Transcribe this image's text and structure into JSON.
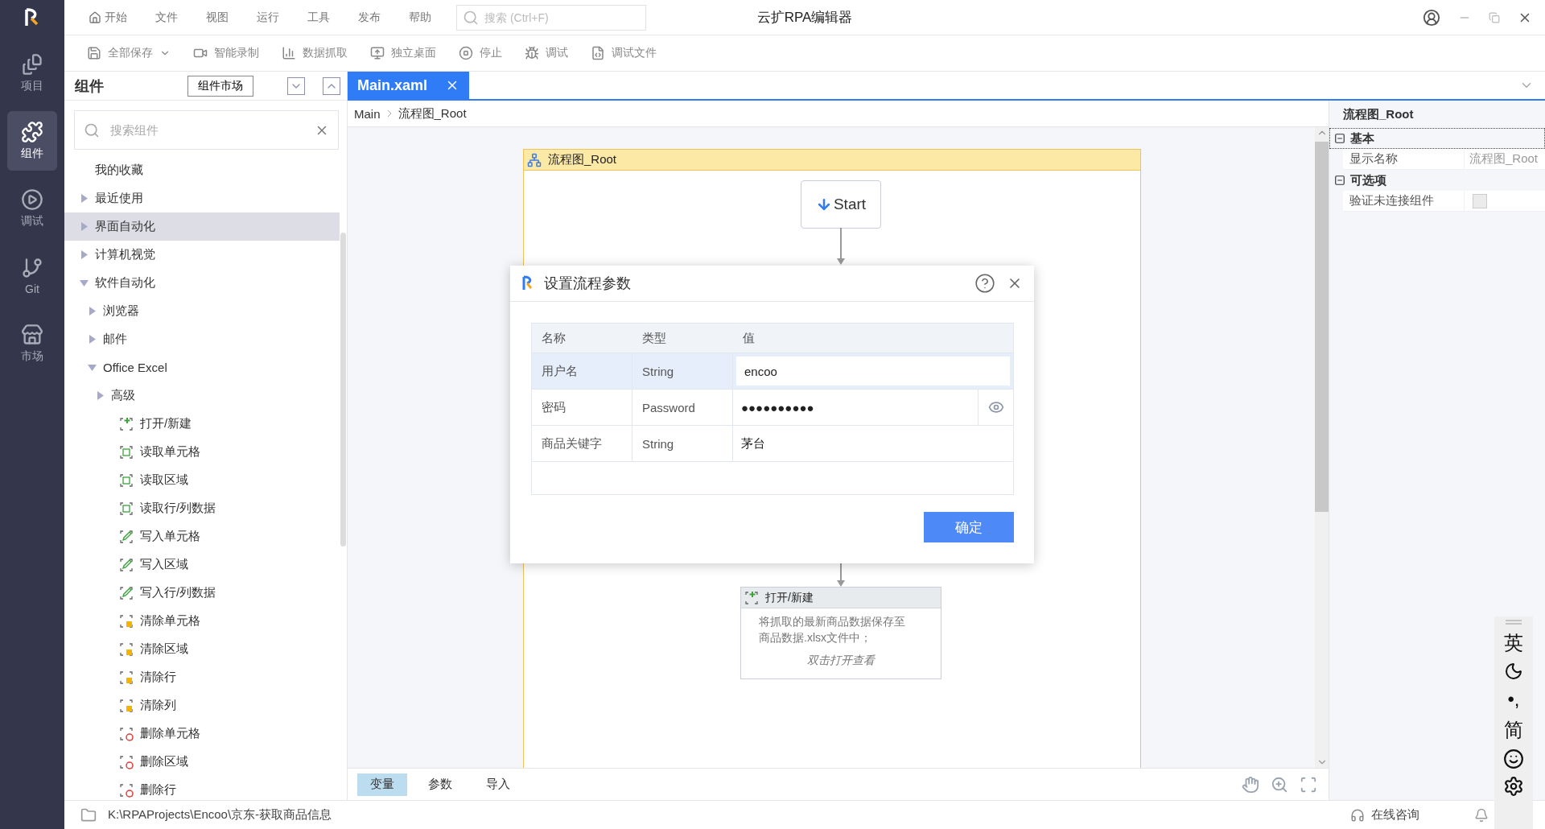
{
  "window": {
    "title": "云扩RPA编辑器"
  },
  "menu": [
    {
      "label": "开始",
      "kind": "home"
    },
    {
      "label": "文件",
      "kind": "text"
    },
    {
      "label": "视图",
      "kind": "text"
    },
    {
      "label": "运行",
      "kind": "text"
    },
    {
      "label": "工具",
      "kind": "text"
    },
    {
      "label": "发布",
      "kind": "text"
    },
    {
      "label": "帮助",
      "kind": "text"
    }
  ],
  "search": {
    "placeholder": "搜索 (Ctrl+F)"
  },
  "toolbar": [
    {
      "label": "全部保存",
      "kind": "save"
    },
    {
      "label": "智能录制",
      "kind": "record"
    },
    {
      "label": "数据抓取",
      "kind": "extract"
    },
    {
      "label": "独立桌面",
      "kind": "desktop"
    },
    {
      "label": "停止",
      "kind": "stop"
    },
    {
      "label": "调试",
      "kind": "debug"
    },
    {
      "label": "调试文件",
      "kind": "debugfile"
    }
  ],
  "rail": [
    {
      "label": "项目",
      "kind": "project",
      "selected": false
    },
    {
      "label": "组件",
      "kind": "components",
      "selected": true
    },
    {
      "label": "调试",
      "kind": "debug",
      "selected": false
    },
    {
      "label": "Git",
      "kind": "git",
      "selected": false
    },
    {
      "label": "市场",
      "kind": "market",
      "selected": false
    }
  ],
  "panel": {
    "title": "组件",
    "market_button": "组件市场",
    "search_placeholder": "搜索组件",
    "tree": [
      {
        "label": "我的收藏",
        "kind": "item",
        "selected": false
      },
      {
        "label": "最近使用",
        "kind": "group",
        "expanded": false,
        "selected": false
      },
      {
        "label": "界面自动化",
        "kind": "group",
        "expanded": false,
        "selected": true
      },
      {
        "label": "计算机视觉",
        "kind": "group",
        "expanded": false,
        "selected": false
      },
      {
        "label": "软件自动化",
        "kind": "group",
        "expanded": true,
        "selected": false,
        "children": [
          {
            "label": "浏览器",
            "kind": "group",
            "expanded": false,
            "selected": false
          },
          {
            "label": "邮件",
            "kind": "group",
            "expanded": false,
            "selected": false
          },
          {
            "label": "Office Excel",
            "kind": "group",
            "expanded": true,
            "selected": false,
            "children": [
              {
                "label": "高级",
                "kind": "group",
                "expanded": false,
                "selected": false
              },
              {
                "label": "打开/新建",
                "kind": "open",
                "selected": false
              },
              {
                "label": "读取单元格",
                "kind": "read",
                "selected": false
              },
              {
                "label": "读取区域",
                "kind": "read",
                "selected": false
              },
              {
                "label": "读取行/列数据",
                "kind": "read",
                "selected": false
              },
              {
                "label": "写入单元格",
                "kind": "write",
                "selected": false
              },
              {
                "label": "写入区域",
                "kind": "write",
                "selected": false
              },
              {
                "label": "写入行/列数据",
                "kind": "write",
                "selected": false
              },
              {
                "label": "清除单元格",
                "kind": "clear",
                "selected": false
              },
              {
                "label": "清除区域",
                "kind": "clear",
                "selected": false
              },
              {
                "label": "清除行",
                "kind": "clear",
                "selected": false
              },
              {
                "label": "清除列",
                "kind": "clear",
                "selected": false
              },
              {
                "label": "删除单元格",
                "kind": "delete",
                "selected": false
              },
              {
                "label": "删除区域",
                "kind": "delete",
                "selected": false
              },
              {
                "label": "删除行",
                "kind": "delete",
                "selected": false
              }
            ]
          }
        ]
      }
    ]
  },
  "tabs": [
    {
      "label": "Main.xaml",
      "selected": true
    }
  ],
  "breadcrumb": [
    "Main",
    "流程图_Root"
  ],
  "flowchart": {
    "title": "流程图_Root",
    "start": "Start",
    "activity": {
      "title": "打开/新建",
      "description": "将抓取的最新商品数据保存至商品数据.xlsx文件中；",
      "hint": "双击打开查看"
    }
  },
  "dialog": {
    "title": "设置流程参数",
    "columns": [
      "名称",
      "类型",
      "值"
    ],
    "rows": [
      {
        "name": "用户名",
        "type": "String",
        "value": "encoo",
        "kind": "text",
        "selected": true
      },
      {
        "name": "密码",
        "type": "Password",
        "value": "●●●●●●●●●●",
        "kind": "password",
        "selected": false
      },
      {
        "name": "商品关键字",
        "type": "String",
        "value": "茅台",
        "kind": "text",
        "selected": false
      }
    ],
    "ok_button": "确定"
  },
  "properties": {
    "title": "流程图_Root",
    "sections": [
      {
        "label": "基本",
        "expanded": true,
        "rows": [
          {
            "label": "显示名称",
            "kind": "text",
            "value": "流程图_Root"
          }
        ]
      },
      {
        "label": "可选项",
        "expanded": true,
        "rows": [
          {
            "label": "验证未连接组件",
            "kind": "checkbox",
            "checked": false
          }
        ]
      }
    ]
  },
  "bottom_tabs": [
    {
      "label": "变量",
      "selected": true
    },
    {
      "label": "参数",
      "selected": false
    },
    {
      "label": "导入",
      "selected": false
    }
  ],
  "status": {
    "path": "K:\\RPAProjects\\Encoo\\京东-获取商品信息",
    "support": "在线咨询"
  },
  "ime": [
    {
      "kind": "text",
      "label": "英"
    },
    {
      "kind": "moon"
    },
    {
      "kind": "text",
      "label": "•,"
    },
    {
      "kind": "text",
      "label": "简"
    },
    {
      "kind": "smile"
    },
    {
      "kind": "gear"
    }
  ]
}
